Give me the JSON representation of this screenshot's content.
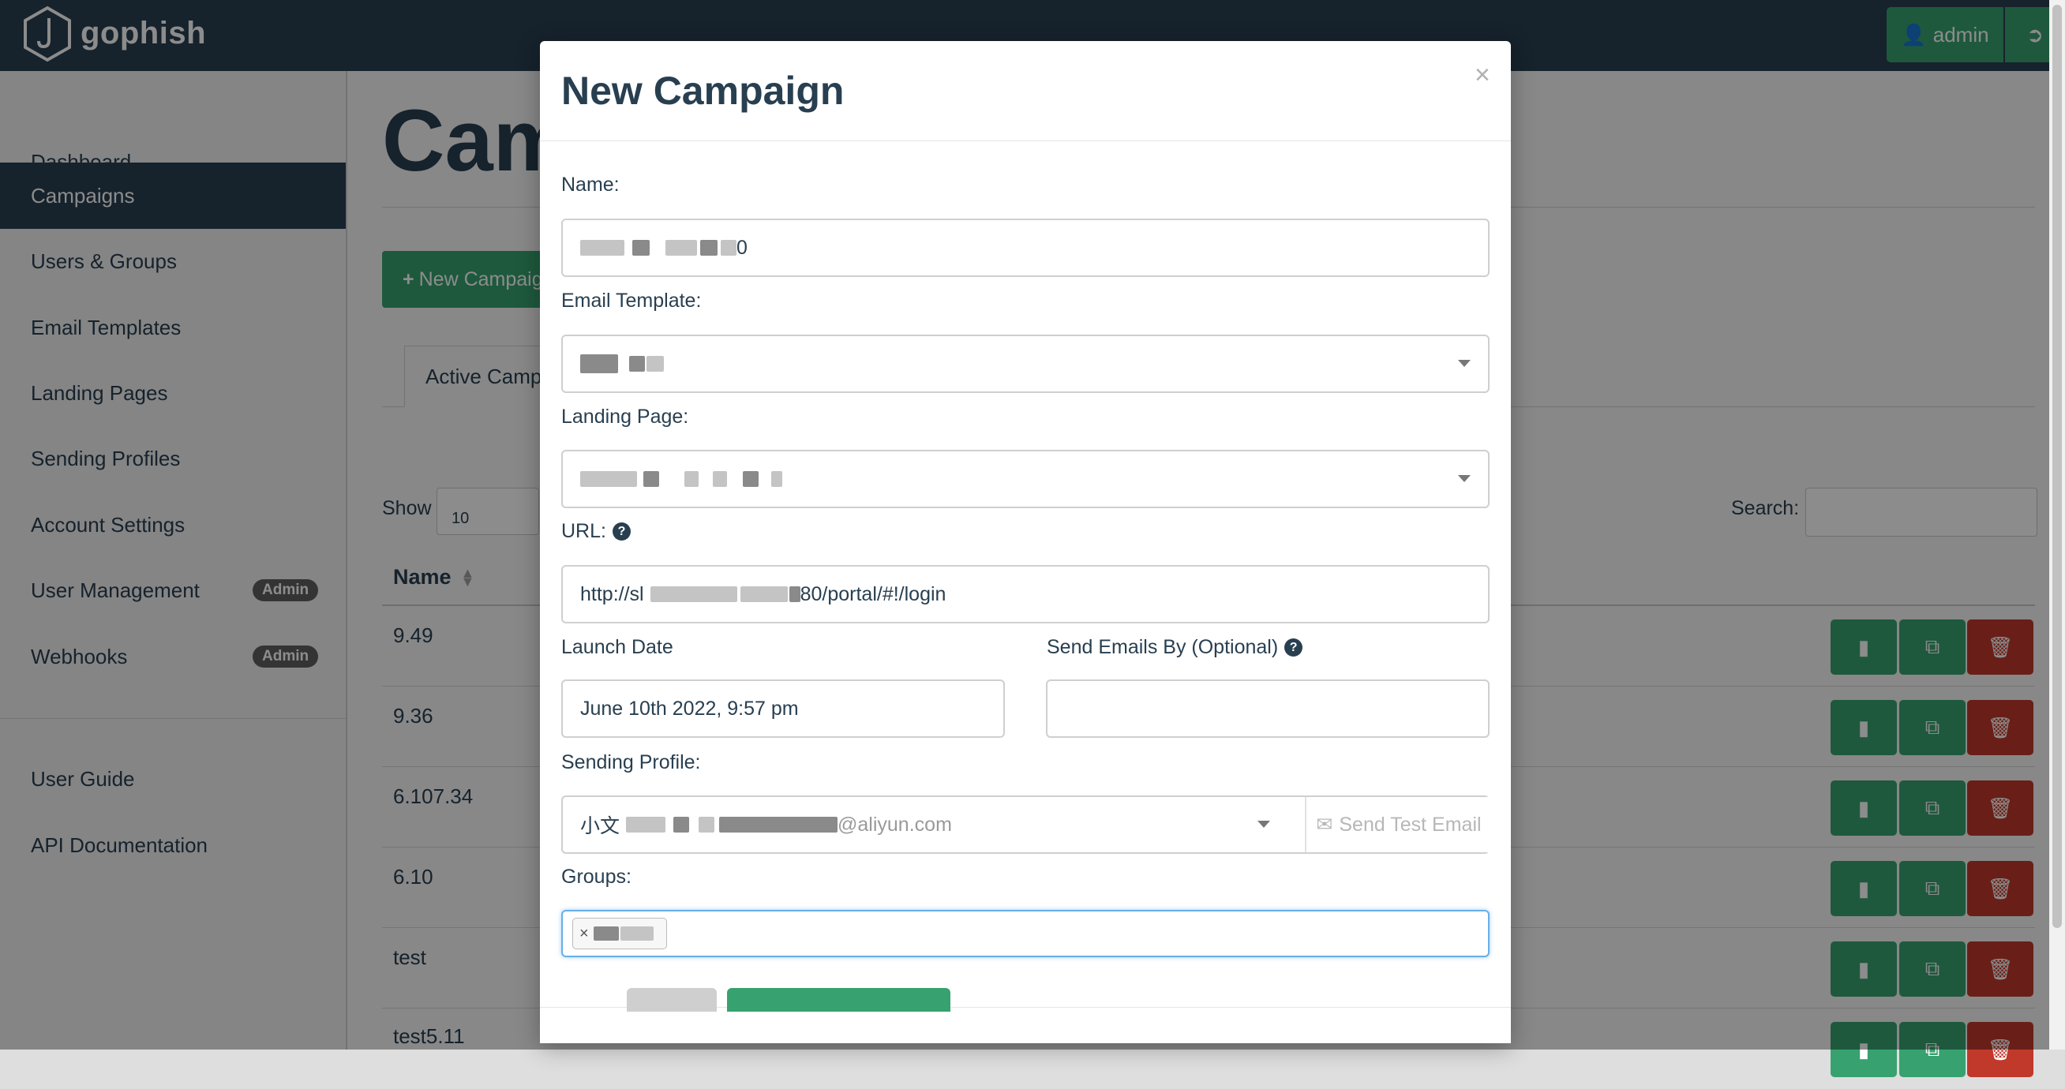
{
  "navbar": {
    "brand": "gophish",
    "user_label": "admin",
    "colors": {
      "navbar_bg": "#283f50",
      "accent_green": "#37a26f",
      "danger_red": "#c0392b"
    }
  },
  "sidebar": {
    "items": [
      {
        "label": "Dashboard"
      },
      {
        "label": "Campaigns",
        "active": true
      },
      {
        "label": "Users & Groups"
      },
      {
        "label": "Email Templates"
      },
      {
        "label": "Landing Pages"
      },
      {
        "label": "Sending Profiles"
      },
      {
        "label": "Account Settings"
      },
      {
        "label": "User Management",
        "badge": "Admin"
      },
      {
        "label": "Webhooks",
        "badge": "Admin"
      }
    ],
    "footer_items": [
      {
        "label": "User Guide"
      },
      {
        "label": "API Documentation"
      }
    ]
  },
  "main": {
    "title": "Cam",
    "new_campaign_label": "New Campaig",
    "tab_active": "Active Camp",
    "show_label": "Show",
    "show_value": "10",
    "search_label": "Search:",
    "column_name": "Name",
    "rows": [
      {
        "name": "9.49"
      },
      {
        "name": "9.36"
      },
      {
        "name": "6.107.34"
      },
      {
        "name": "6.10"
      },
      {
        "name": "test"
      },
      {
        "name": "test5.11"
      }
    ]
  },
  "modal": {
    "title": "New Campaign",
    "close_symbol": "×",
    "name_label": "Name:",
    "name_value_suffix": "0",
    "email_template_label": "Email Template:",
    "landing_page_label": "Landing Page:",
    "url_label": "URL:",
    "url_prefix": "http://sl",
    "url_suffix": "80/portal/#!/login",
    "launch_date_label": "Launch Date",
    "launch_date_value": "June 10th 2022, 9:57 pm",
    "send_by_label": "Send Emails By (Optional)",
    "sending_profile_label": "Sending Profile:",
    "sending_profile_prefix": "小文",
    "sending_profile_suffix": "@aliyun.com",
    "send_test_label": "Send Test Email",
    "groups_label": "Groups:",
    "group_tag_remove": "×"
  }
}
